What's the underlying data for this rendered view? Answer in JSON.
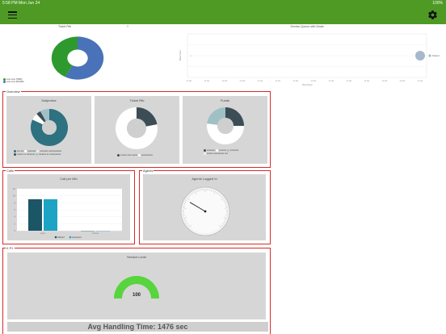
{
  "status_bar": {
    "time": "5:58 PM  Mon Jun 24",
    "battery": "100%"
  },
  "colors": {
    "app_green": "#4e9a25",
    "section_red": "#d62a2a",
    "teal": "#2e7180",
    "dark_slate": "#3c4d56",
    "light_teal": "#9fc1c6",
    "gauge_green": "#58d43e"
  },
  "icons": {
    "menu": "hamburger-menu-icon",
    "settings": "gear-icon"
  },
  "top_left": {
    "title": "Ticket Rtb",
    "legend": [
      "xxxx xxxx (7000)",
      "xxxx xxxx (29,000)"
    ],
    "chart_data": {
      "type": "pie",
      "values": [
        58,
        42
      ],
      "colors": [
        "#4a72b8",
        "#2e9a2e"
      ]
    }
  },
  "top_right": {
    "title": "Service Queue with Deals",
    "ylabel": "Ticket Count",
    "xlabel": "Time Period",
    "legend": "Series 1",
    "chart_data": {
      "type": "scatter",
      "x_ticks": [
        "xx xxx",
        "xx xxx",
        "xx xxx",
        "xx xxx",
        "xx xxx",
        "xx xxx",
        "xx xxx",
        "xx xxx",
        "xx xxx",
        "xx xxx",
        "xx xxx",
        "xx xxx",
        "xx xxx",
        "xx xxx"
      ],
      "points": [
        {
          "x": 13,
          "y": 0.5
        }
      ]
    }
  },
  "sections": {
    "overview": {
      "label": "Overview",
      "cards": [
        {
          "title": "Subjective",
          "chart_data": {
            "type": "pie",
            "values": [
              82,
              6,
              4,
              8
            ],
            "colors": [
              "#2e7180",
              "#ffffff",
              "#3c4d56",
              "#9fc1c6"
            ]
          },
          "legend": [
            "xxx xxx",
            "xxxxxxxx",
            "xxxxxxxx xxxxxxxxxxxx",
            "xxxxxx xx xxxxxxxx",
            "xxxxxxx xx xxxxxxxxxxx"
          ]
        },
        {
          "title": "Ticket Rtb",
          "chart_data": {
            "type": "pie",
            "values": [
              22,
              78
            ],
            "colors": [
              "#3c4d56",
              "#ffffff"
            ]
          },
          "legend": [
            "xxxxxx xxxx xxxxx",
            "xxxxxxxxxxx"
          ]
        },
        {
          "title": "Funds",
          "chart_data": {
            "type": "pie",
            "values": [
              25,
              52,
              23
            ],
            "colors": [
              "#3c4d56",
              "#ffffff",
              "#9fc1c6"
            ]
          },
          "legend": [
            "xxxxxxxx",
            "xxxxxxx",
            "xxxxxxxx",
            "xxxxxx xxxxxxxxxx xxx"
          ]
        }
      ]
    },
    "calls": {
      "label": "Calls",
      "card_title": "Call per Min",
      "chart_data": {
        "type": "bar",
        "categories": [
          "xxxxx",
          "xxxxxxx"
        ],
        "series": [
          {
            "name": "Offered",
            "values": [
              9,
              0
            ]
          },
          {
            "name": "Answered",
            "values": [
              9,
              0
            ]
          }
        ],
        "ylim": [
          0,
          12
        ]
      },
      "y_ticks": [
        "12",
        "10",
        "8",
        "6",
        "4",
        "2",
        "0"
      ],
      "legend": [
        "Offered",
        "Answered"
      ]
    },
    "agents": {
      "label": "Agents",
      "card_title": "Agents Logged In",
      "chart_data": {
        "type": "gauge",
        "value": 14,
        "max": 50
      }
    },
    "kpi": {
      "label": "K.P.I.",
      "card_title": "Service Level",
      "chart_data": {
        "type": "gauge",
        "value": 100,
        "max": 100
      },
      "value_label": "100",
      "aht_label": "Avg Handling Time: 1476 sec"
    }
  }
}
